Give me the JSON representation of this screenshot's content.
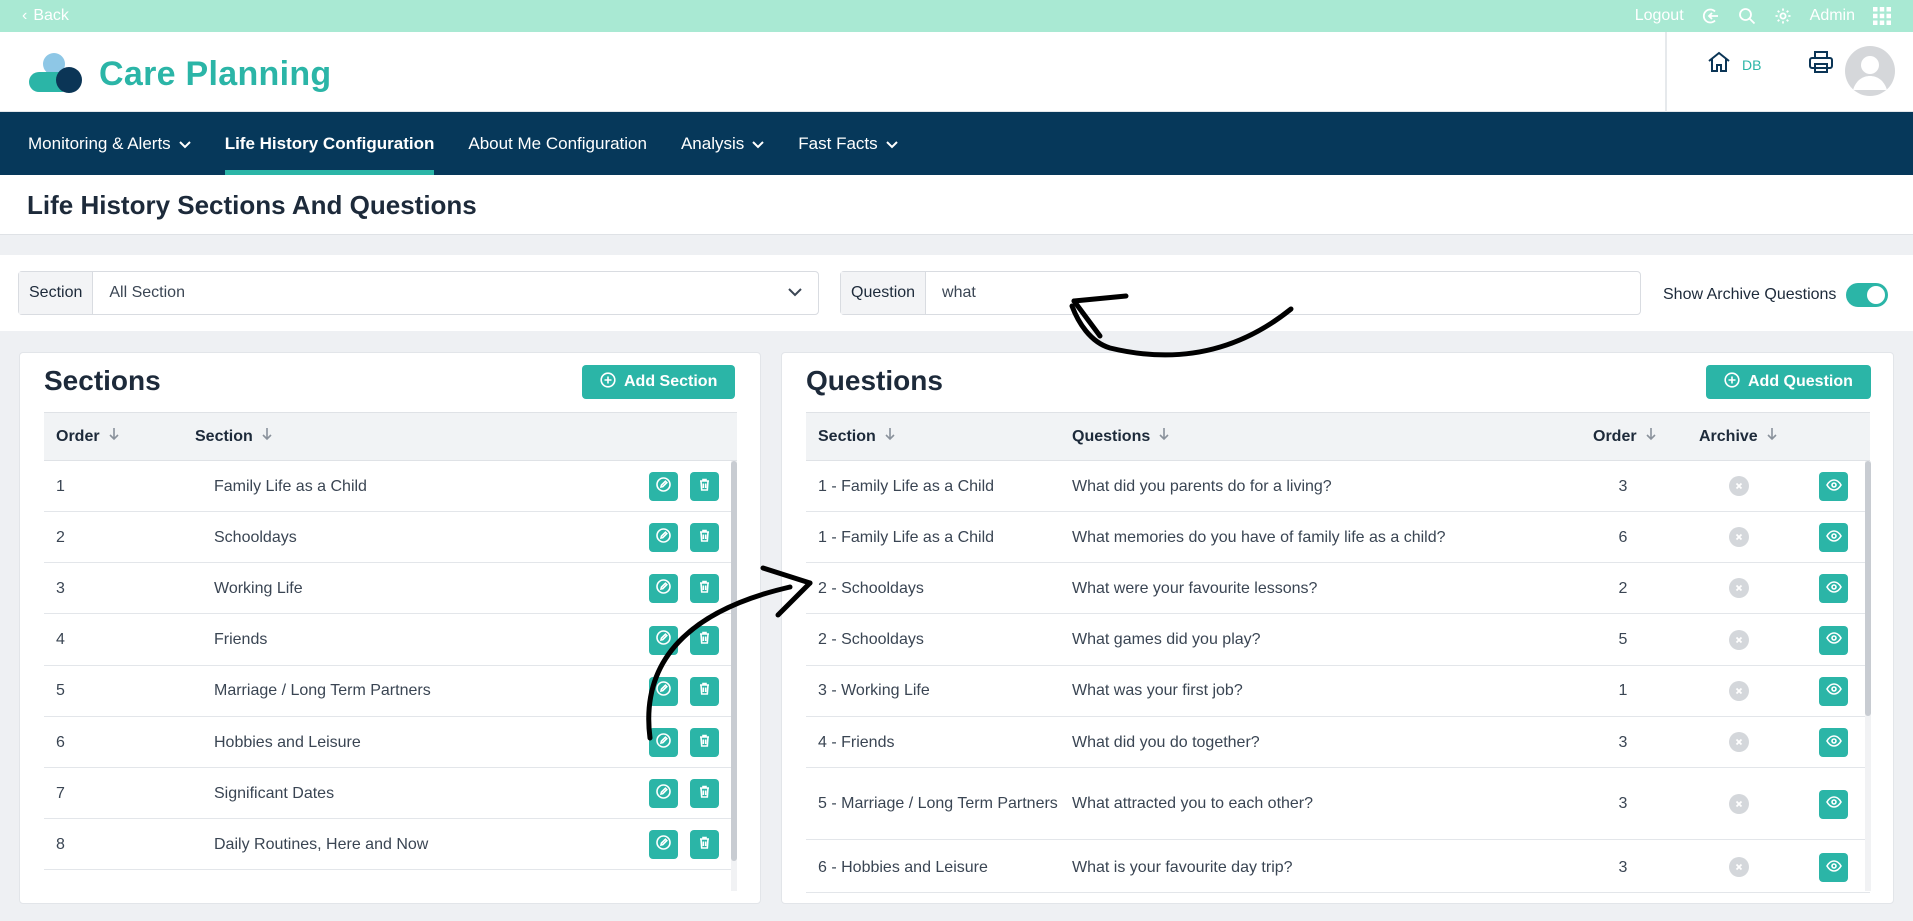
{
  "topbar": {
    "back_label": "Back",
    "logout_label": "Logout",
    "admin_label": "Admin"
  },
  "header": {
    "app_title": "Care Planning",
    "db_label": "DB"
  },
  "nav": {
    "items": [
      {
        "label": "Monitoring & Alerts",
        "dropdown": true
      },
      {
        "label": "Life History Configuration",
        "active": true
      },
      {
        "label": "About Me Configuration"
      },
      {
        "label": "Analysis",
        "dropdown": true
      },
      {
        "label": "Fast Facts",
        "dropdown": true
      }
    ]
  },
  "page": {
    "title": "Life History Sections And Questions"
  },
  "filters": {
    "section_label": "Section",
    "section_value": "All Section",
    "question_label": "Question",
    "question_value": "what",
    "archive_toggle_label": "Show Archive Questions",
    "archive_toggle_on": true
  },
  "sections_panel": {
    "title": "Sections",
    "add_label": "Add Section",
    "headers": {
      "order": "Order",
      "section": "Section"
    },
    "rows": [
      {
        "order": "1",
        "section": "Family Life as a Child"
      },
      {
        "order": "2",
        "section": "Schooldays"
      },
      {
        "order": "3",
        "section": "Working Life"
      },
      {
        "order": "4",
        "section": "Friends"
      },
      {
        "order": "5",
        "section": "Marriage / Long Term Partners"
      },
      {
        "order": "6",
        "section": "Hobbies and Leisure"
      },
      {
        "order": "7",
        "section": "Significant Dates"
      },
      {
        "order": "8",
        "section": "Daily Routines, Here and Now"
      }
    ]
  },
  "questions_panel": {
    "title": "Questions",
    "add_label": "Add Question",
    "headers": {
      "section": "Section",
      "questions": "Questions",
      "order": "Order",
      "archive": "Archive"
    },
    "rows": [
      {
        "section": "1 - Family Life as a Child",
        "question": "What did you parents do for a living?",
        "order": "3"
      },
      {
        "section": "1 - Family Life as a Child",
        "question": "What memories do you have of family life as a child?",
        "order": "6"
      },
      {
        "section": "2 - Schooldays",
        "question": "What were your favourite lessons?",
        "order": "2"
      },
      {
        "section": "2 - Schooldays",
        "question": "What games did you play?",
        "order": "5"
      },
      {
        "section": "3 - Working Life",
        "question": "What was your first job?",
        "order": "1"
      },
      {
        "section": "4 - Friends",
        "question": "What did you do together?",
        "order": "3"
      },
      {
        "section": "5 - Marriage / Long Term Partners",
        "question": "What attracted you to each other?",
        "order": "3"
      },
      {
        "section": "6 - Hobbies and Leisure",
        "question": "What is your favourite day trip?",
        "order": "3"
      }
    ]
  },
  "colors": {
    "accent": "#2bb5a7",
    "nav_bg": "#06385a",
    "topbar_bg": "#a9e9d3"
  }
}
